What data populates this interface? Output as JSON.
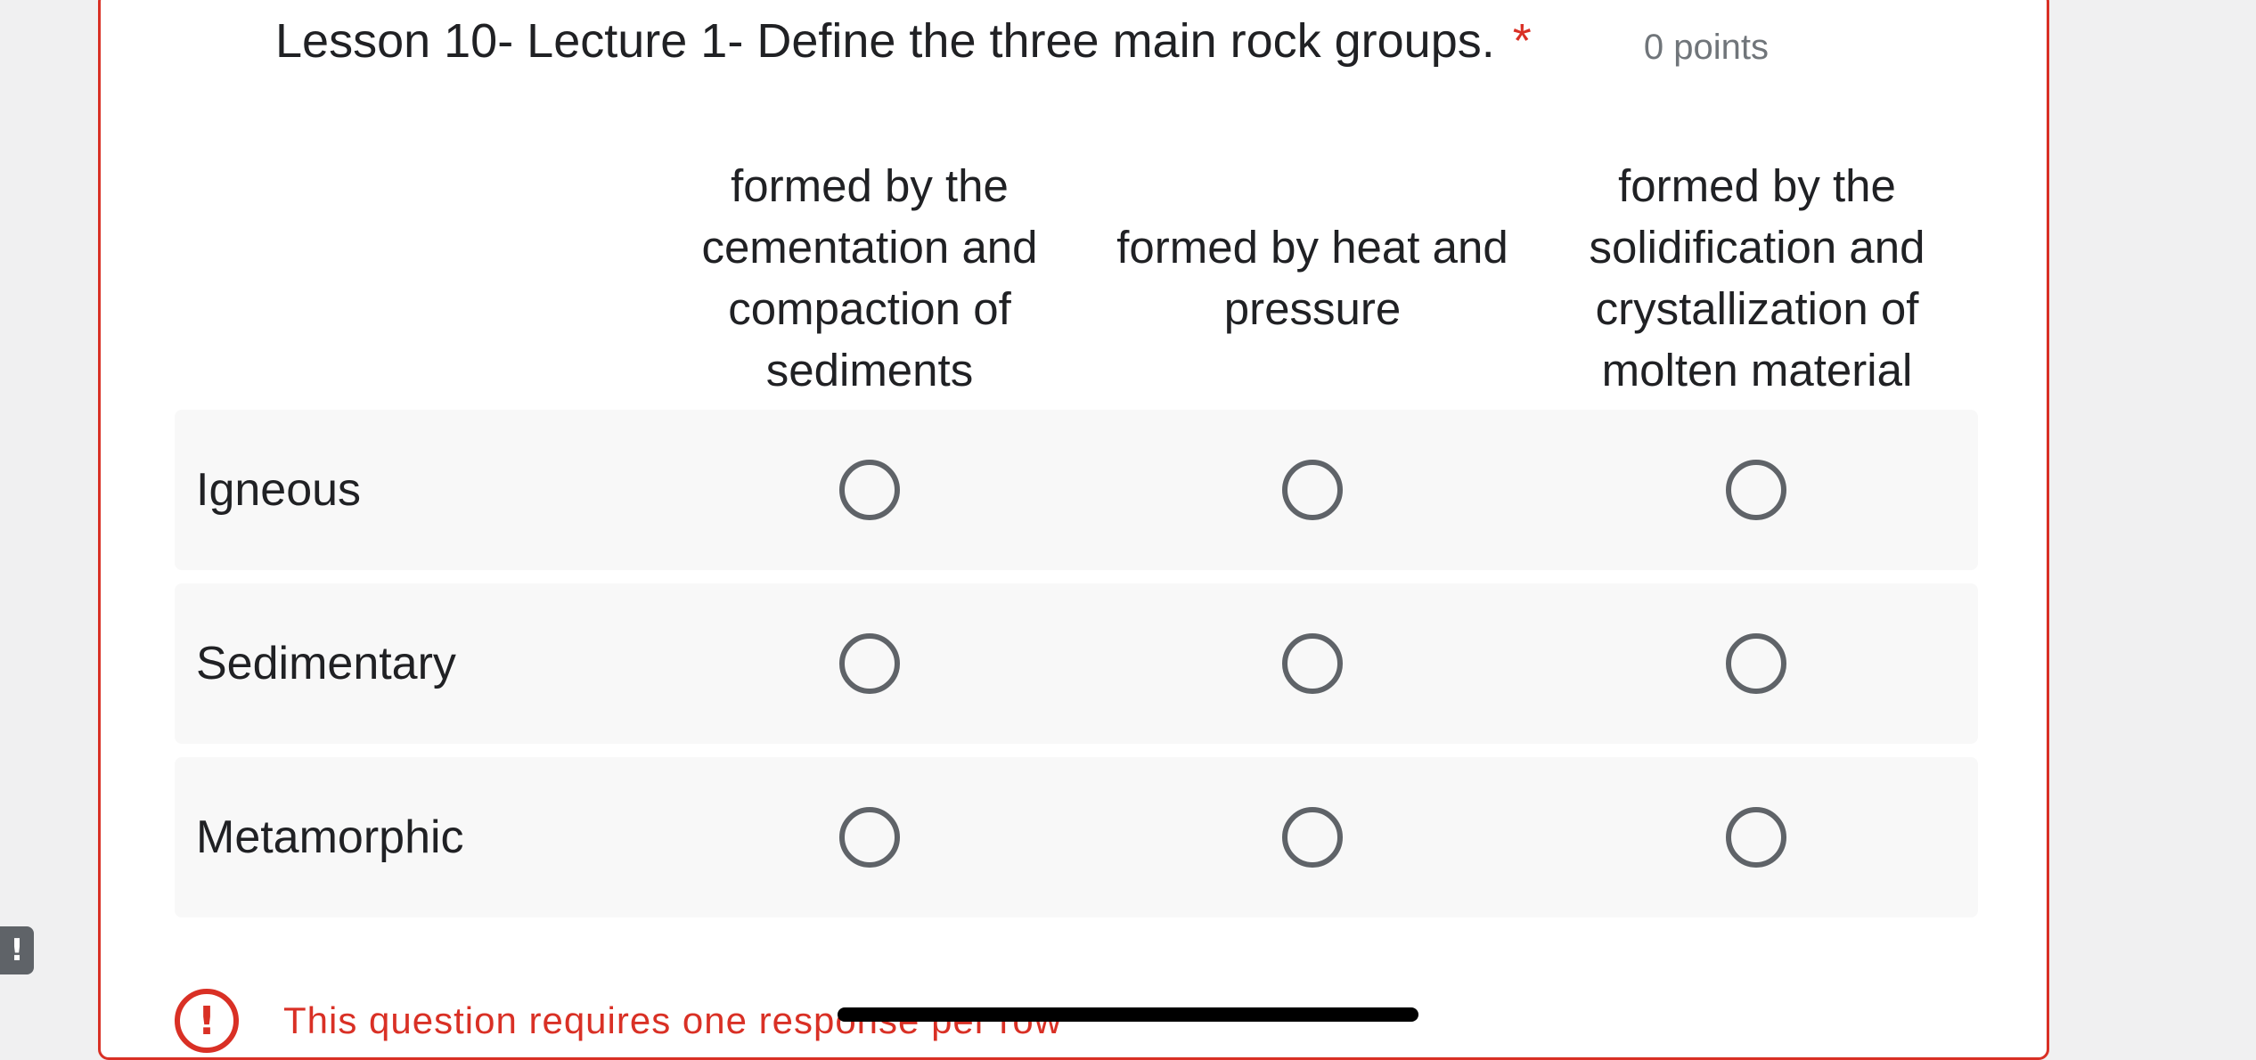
{
  "question": {
    "title": "Lesson 10- Lecture 1- Define the three main rock groups.",
    "required_marker": "*",
    "points": "0 points"
  },
  "columns": [
    {
      "label": "formed by the cementation and compaction of sediments"
    },
    {
      "label": "formed by heat and pressure"
    },
    {
      "label": "formed by the solidification and crystallization of molten material"
    }
  ],
  "rows": [
    {
      "label": "Igneous"
    },
    {
      "label": "Sedimentary"
    },
    {
      "label": "Metamorphic"
    }
  ],
  "error": {
    "icon_symbol": "!",
    "message": "This question requires one response per row"
  },
  "feedback_tab": {
    "icon_symbol": "!"
  },
  "colors": {
    "accent_error": "#d93025",
    "radio_border": "#5f6368",
    "row_background": "#f8f8f8"
  },
  "icons": {
    "error": "error-circle-icon",
    "feedback": "feedback-exclamation-icon"
  }
}
